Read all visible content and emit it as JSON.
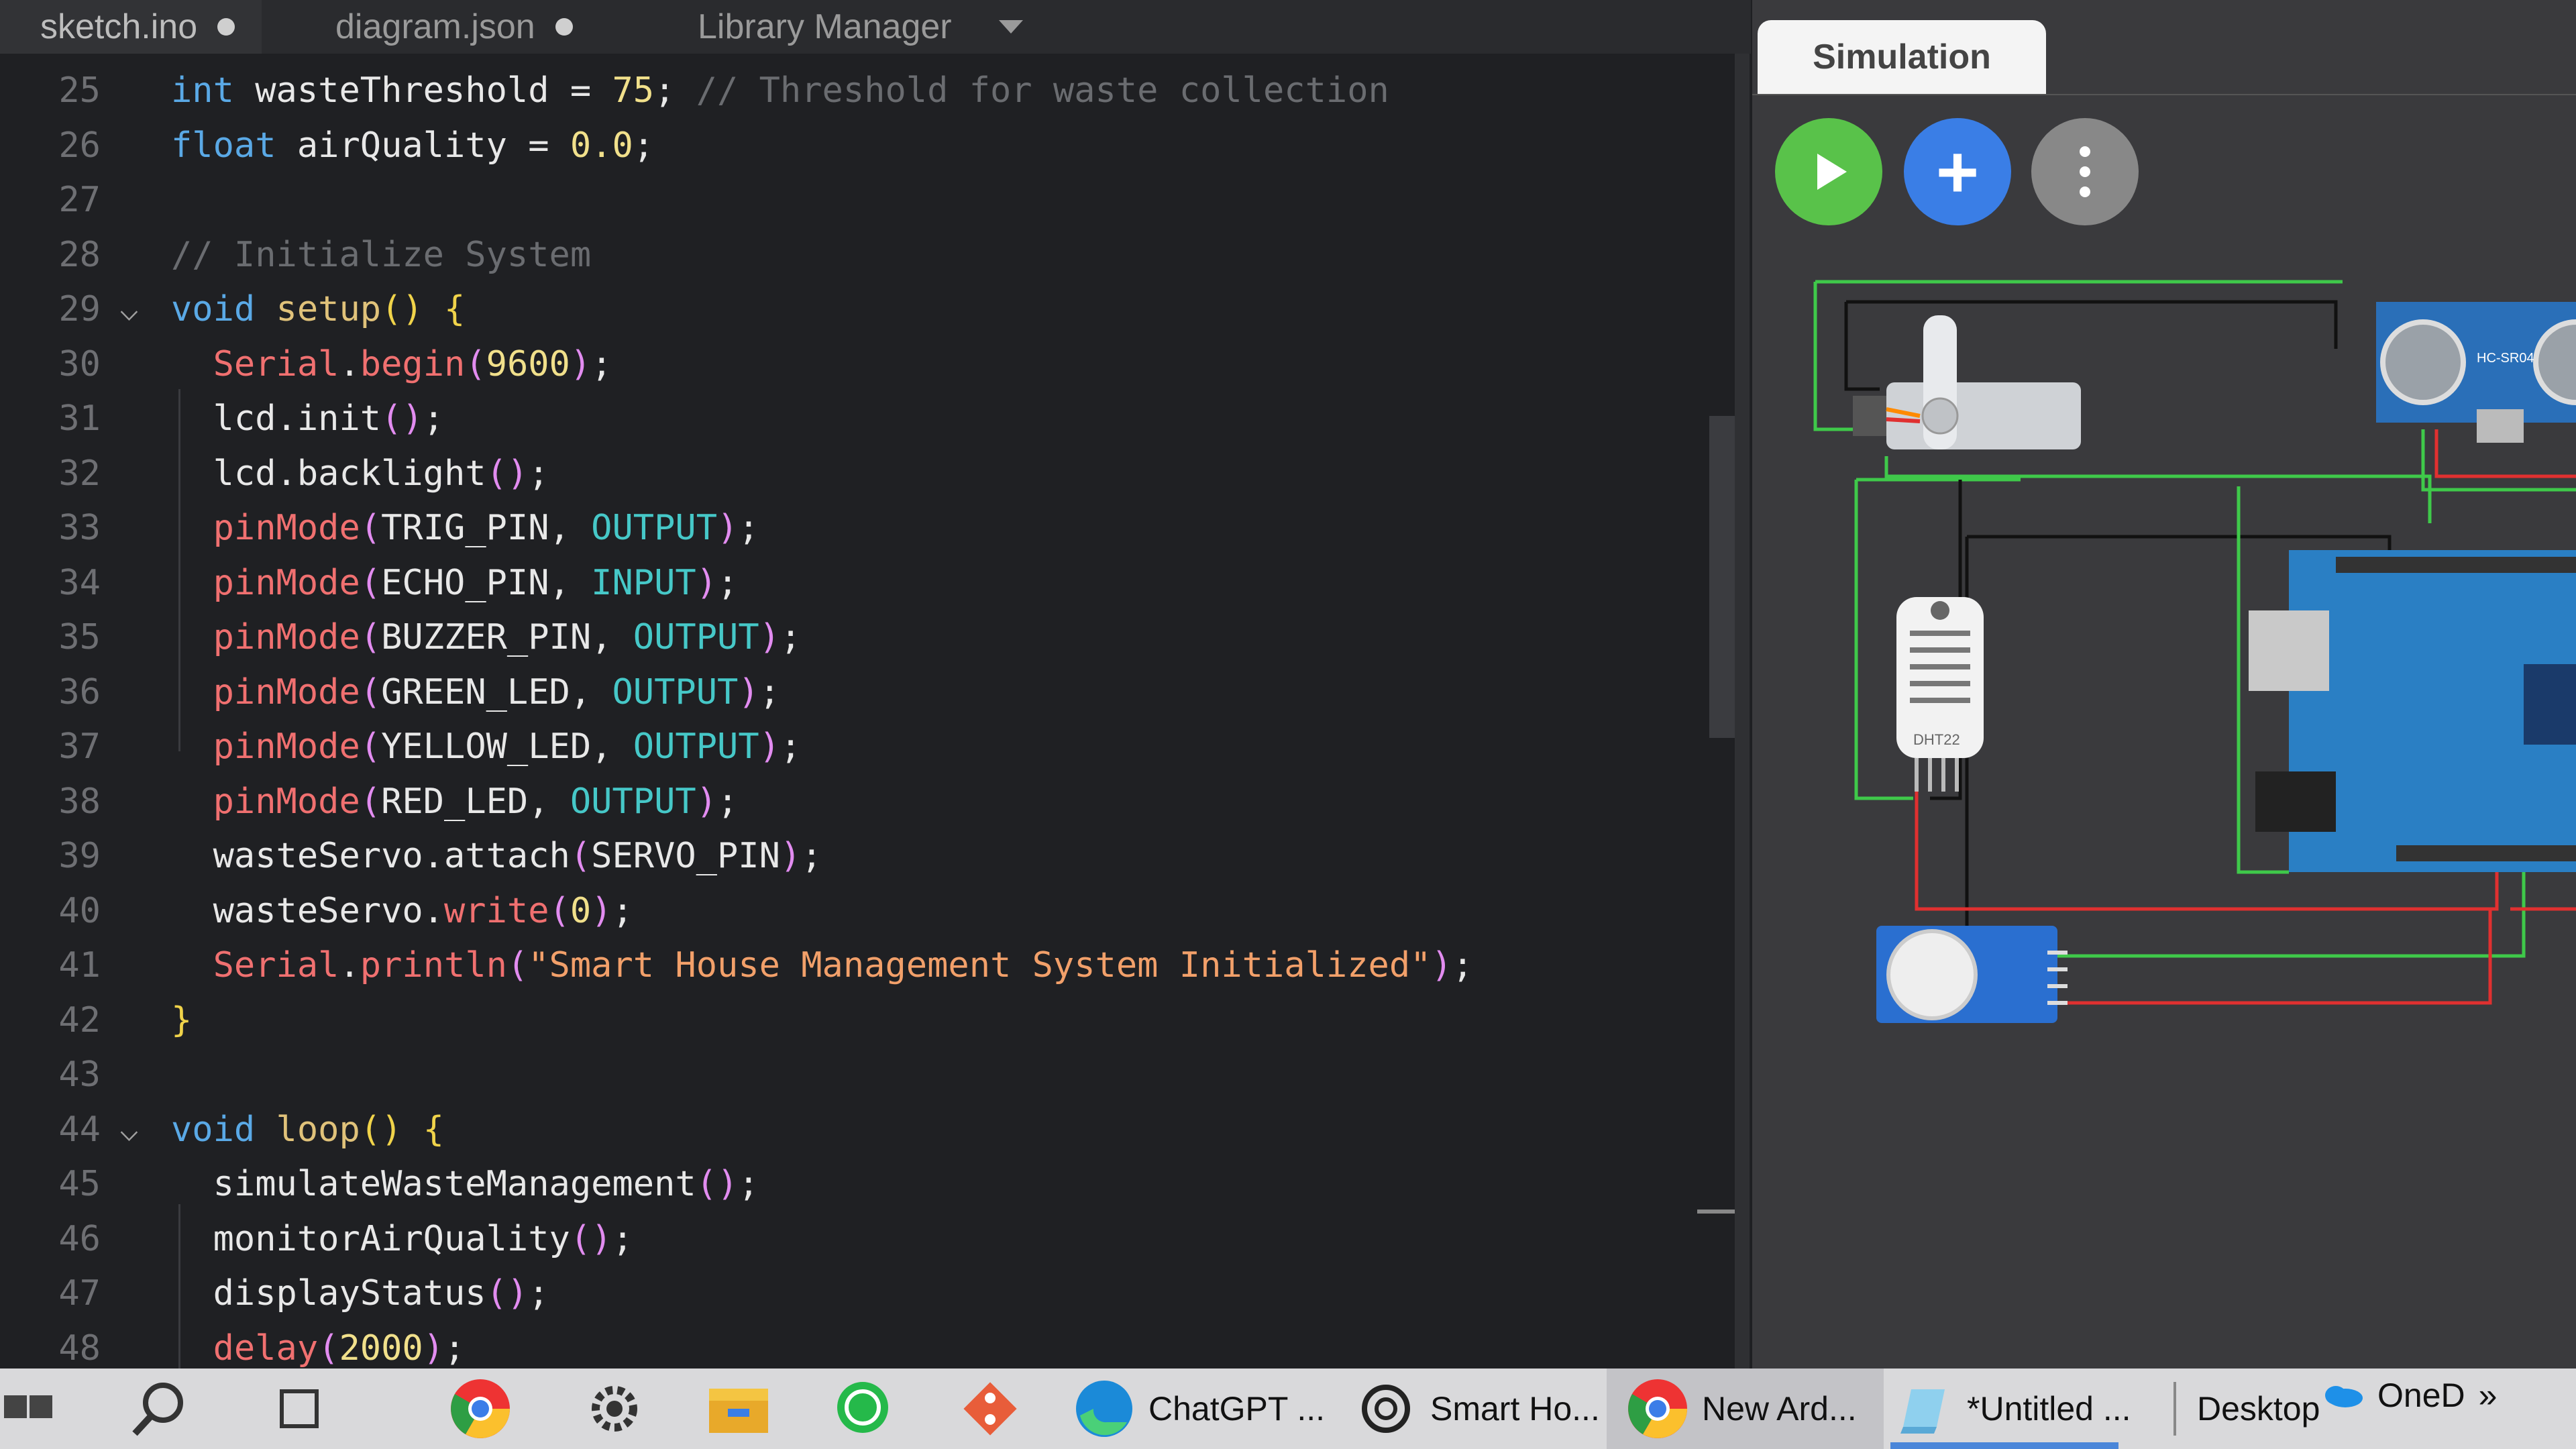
{
  "tabs": [
    {
      "label": "sketch.ino"
    },
    {
      "label": "diagram.json"
    },
    {
      "label": "Library Manager"
    }
  ],
  "editor": {
    "lines": [
      {
        "n": "25",
        "fold": "",
        "segs": [
          [
            "kw",
            "int"
          ],
          [
            "plain",
            " wasteThreshold = "
          ],
          [
            "num",
            "75"
          ],
          [
            "plain",
            "; "
          ],
          [
            "com",
            "// Threshold for waste collection"
          ]
        ]
      },
      {
        "n": "26",
        "fold": "",
        "segs": [
          [
            "kw",
            "float"
          ],
          [
            "plain",
            " airQuality = "
          ],
          [
            "num",
            "0.0"
          ],
          [
            "plain",
            ";"
          ]
        ]
      },
      {
        "n": "27",
        "fold": "",
        "segs": []
      },
      {
        "n": "28",
        "fold": "",
        "segs": [
          [
            "com",
            "// Initialize System"
          ]
        ]
      },
      {
        "n": "29",
        "fold": "v",
        "segs": [
          [
            "kw",
            "void"
          ],
          [
            "plain",
            " "
          ],
          [
            "fn",
            "setup"
          ],
          [
            "br",
            "() {"
          ]
        ]
      },
      {
        "n": "30",
        "fold": "",
        "segs": [
          [
            "plain",
            "  "
          ],
          [
            "red",
            "Serial"
          ],
          [
            "plain",
            "."
          ],
          [
            "red",
            "begin"
          ],
          [
            "pu",
            "("
          ],
          [
            "num",
            "9600"
          ],
          [
            "pu",
            ")"
          ],
          [
            "plain",
            ";"
          ]
        ]
      },
      {
        "n": "31",
        "fold": "",
        "segs": [
          [
            "plain",
            "  lcd.init"
          ],
          [
            "pu",
            "()"
          ],
          [
            "plain",
            ";"
          ]
        ]
      },
      {
        "n": "32",
        "fold": "",
        "segs": [
          [
            "plain",
            "  lcd.backlight"
          ],
          [
            "pu",
            "()"
          ],
          [
            "plain",
            ";"
          ]
        ]
      },
      {
        "n": "33",
        "fold": "",
        "segs": [
          [
            "plain",
            "  "
          ],
          [
            "red",
            "pinMode"
          ],
          [
            "pu",
            "("
          ],
          [
            "plain",
            "TRIG_PIN, "
          ],
          [
            "cyan",
            "OUTPUT"
          ],
          [
            "pu",
            ")"
          ],
          [
            "plain",
            ";"
          ]
        ]
      },
      {
        "n": "34",
        "fold": "",
        "segs": [
          [
            "plain",
            "  "
          ],
          [
            "red",
            "pinMode"
          ],
          [
            "pu",
            "("
          ],
          [
            "plain",
            "ECHO_PIN, "
          ],
          [
            "cyan",
            "INPUT"
          ],
          [
            "pu",
            ")"
          ],
          [
            "plain",
            ";"
          ]
        ]
      },
      {
        "n": "35",
        "fold": "",
        "segs": [
          [
            "plain",
            "  "
          ],
          [
            "red",
            "pinMode"
          ],
          [
            "pu",
            "("
          ],
          [
            "plain",
            "BUZZER_PIN, "
          ],
          [
            "cyan",
            "OUTPUT"
          ],
          [
            "pu",
            ")"
          ],
          [
            "plain",
            ";"
          ]
        ]
      },
      {
        "n": "36",
        "fold": "",
        "segs": [
          [
            "plain",
            "  "
          ],
          [
            "red",
            "pinMode"
          ],
          [
            "pu",
            "("
          ],
          [
            "plain",
            "GREEN_LED, "
          ],
          [
            "cyan",
            "OUTPUT"
          ],
          [
            "pu",
            ")"
          ],
          [
            "plain",
            ";"
          ]
        ]
      },
      {
        "n": "37",
        "fold": "",
        "segs": [
          [
            "plain",
            "  "
          ],
          [
            "red",
            "pinMode"
          ],
          [
            "pu",
            "("
          ],
          [
            "plain",
            "YELLOW_LED, "
          ],
          [
            "cyan",
            "OUTPUT"
          ],
          [
            "pu",
            ")"
          ],
          [
            "plain",
            ";"
          ]
        ]
      },
      {
        "n": "38",
        "fold": "",
        "segs": [
          [
            "plain",
            "  "
          ],
          [
            "red",
            "pinMode"
          ],
          [
            "pu",
            "("
          ],
          [
            "plain",
            "RED_LED, "
          ],
          [
            "cyan",
            "OUTPUT"
          ],
          [
            "pu",
            ")"
          ],
          [
            "plain",
            ";"
          ]
        ]
      },
      {
        "n": "39",
        "fold": "",
        "segs": [
          [
            "plain",
            "  wasteServo.attach"
          ],
          [
            "pu",
            "("
          ],
          [
            "plain",
            "SERVO_PIN"
          ],
          [
            "pu",
            ")"
          ],
          [
            "plain",
            ";"
          ]
        ]
      },
      {
        "n": "40",
        "fold": "",
        "segs": [
          [
            "plain",
            "  wasteServo."
          ],
          [
            "red",
            "write"
          ],
          [
            "pu",
            "("
          ],
          [
            "num",
            "0"
          ],
          [
            "pu",
            ")"
          ],
          [
            "plain",
            ";"
          ]
        ]
      },
      {
        "n": "41",
        "fold": "",
        "segs": [
          [
            "plain",
            "  "
          ],
          [
            "red",
            "Serial"
          ],
          [
            "plain",
            "."
          ],
          [
            "red",
            "println"
          ],
          [
            "pu",
            "("
          ],
          [
            "str",
            "\"Smart House Management System Initialized\""
          ],
          [
            "pu",
            ")"
          ],
          [
            "plain",
            ";"
          ]
        ]
      },
      {
        "n": "42",
        "fold": "",
        "segs": [
          [
            "br",
            "}"
          ]
        ]
      },
      {
        "n": "43",
        "fold": "",
        "segs": []
      },
      {
        "n": "44",
        "fold": "v",
        "segs": [
          [
            "kw",
            "void"
          ],
          [
            "plain",
            " "
          ],
          [
            "fn",
            "loop"
          ],
          [
            "br",
            "() {"
          ]
        ]
      },
      {
        "n": "45",
        "fold": "",
        "segs": [
          [
            "plain",
            "  simulateWasteManagement"
          ],
          [
            "pu",
            "()"
          ],
          [
            "plain",
            ";"
          ]
        ]
      },
      {
        "n": "46",
        "fold": "",
        "segs": [
          [
            "plain",
            "  monitorAirQuality"
          ],
          [
            "pu",
            "()"
          ],
          [
            "plain",
            ";"
          ]
        ]
      },
      {
        "n": "47",
        "fold": "",
        "segs": [
          [
            "plain",
            "  displayStatus"
          ],
          [
            "pu",
            "()"
          ],
          [
            "plain",
            ";"
          ]
        ]
      },
      {
        "n": "48",
        "fold": "",
        "segs": [
          [
            "plain",
            "  "
          ],
          [
            "red",
            "delay"
          ],
          [
            "pu",
            "("
          ],
          [
            "num",
            "2000"
          ],
          [
            "pu",
            ")"
          ],
          [
            "plain",
            ";"
          ]
        ]
      }
    ]
  },
  "simulation": {
    "tab_label": "Simulation",
    "add_label": "+",
    "sensor_labels": {
      "dht": "DHT22",
      "ultrasonic": "HC-SR04"
    }
  },
  "taskbar": {
    "apps": [
      {
        "label": "ChatGPT ...",
        "icon": "edge-icon"
      },
      {
        "label": "Smart Ho...",
        "icon": "openai-icon"
      },
      {
        "label": "New Ard...",
        "icon": "chrome-icon"
      },
      {
        "label": "*Untitled ...",
        "icon": "notepad-icon"
      }
    ],
    "desktop_label": "Desktop",
    "onedrive_label": "OneD",
    "overflow_label": "»"
  }
}
